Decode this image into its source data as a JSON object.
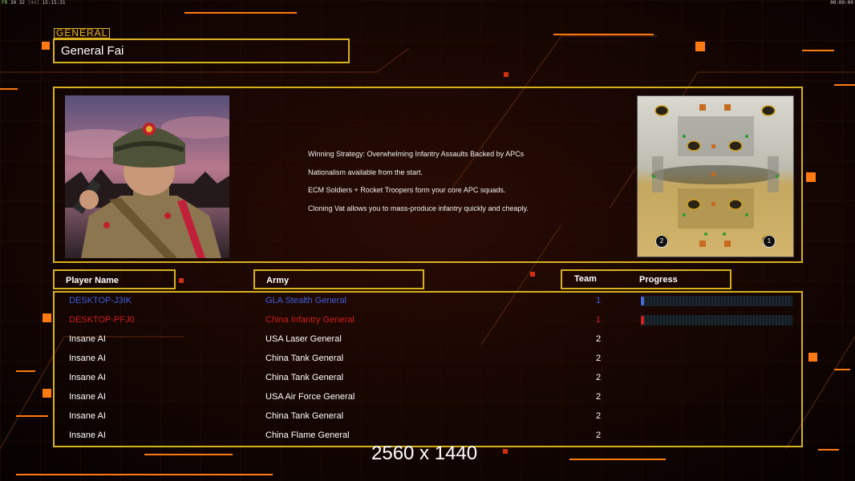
{
  "topbar": {
    "fps_label": "FR",
    "fps_values": "30 32",
    "fps_dim": "[44]",
    "time_left": "15:15:31",
    "time_right": "00:00:00"
  },
  "general": {
    "tag": "GENERAL",
    "name": "General Fai"
  },
  "strategy": [
    "Winning Strategy: Overwhelming Infantry Assaults Backed by APCs",
    "Nationalism available from the start.",
    "ECM Soldiers + Rocket Troopers form your core APC squads.",
    "Cloning Vat allows you to mass-produce infantry quickly and cheaply."
  ],
  "minimap": {
    "markers": [
      "2",
      "1"
    ]
  },
  "headers": {
    "player": "Player Name",
    "army": "Army",
    "team": "Team",
    "progress": "Progress"
  },
  "players": [
    {
      "name": "DESKTOP-J3IK",
      "army": "GLA Stealth General",
      "team": "1",
      "color": "#3e5fe0",
      "progress": 0.02
    },
    {
      "name": "DESKTOP-PFJ0",
      "army": "China Infantry General",
      "team": "1",
      "color": "#d01e1e",
      "progress": 0.02
    },
    {
      "name": "Insane AI",
      "army": "USA Laser General",
      "team": "2"
    },
    {
      "name": "Insane AI",
      "army": "China Tank General",
      "team": "2"
    },
    {
      "name": "Insane AI",
      "army": "China Tank General",
      "team": "2"
    },
    {
      "name": "Insane AI",
      "army": "USA Air Force General",
      "team": "2"
    },
    {
      "name": "Insane AI",
      "army": "China Tank General",
      "team": "2"
    },
    {
      "name": "Insane AI",
      "army": "China Flame General",
      "team": "2"
    }
  ],
  "resolution": "2560 x 1440",
  "colors": {
    "frame": "#d8b21e",
    "accent_orange": "#ff7a12",
    "background": "#0b0302"
  }
}
